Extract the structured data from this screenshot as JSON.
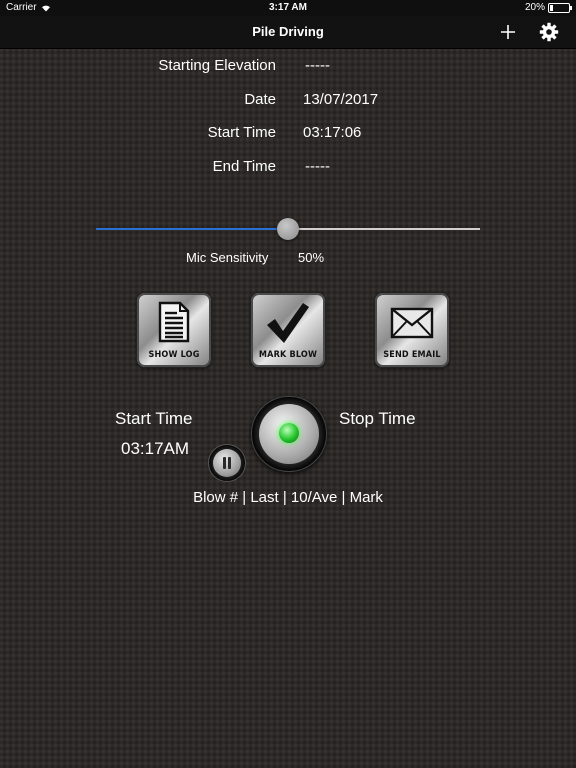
{
  "status_bar": {
    "carrier": "Carrier",
    "time": "3:17 AM",
    "battery": "20%"
  },
  "nav": {
    "title": "Pile Driving",
    "add_icon": "plus-icon",
    "settings_icon": "gear-icon"
  },
  "info": {
    "starting_elevation_label": "Starting Elevation",
    "starting_elevation_value": "-----",
    "date_label": "Date",
    "date_value": "13/07/2017",
    "start_time_label": "Start Time",
    "start_time_value": "03:17:06",
    "end_time_label": "End Time",
    "end_time_value": "-----"
  },
  "mic": {
    "label": "Mic Sensitivity",
    "value_text": "50%",
    "level": 0.5
  },
  "actions": {
    "show_log": {
      "label": "SHOW LOG",
      "icon": "document-icon"
    },
    "mark_blow": {
      "label": "MARK BLOW",
      "icon": "checkmark-icon"
    },
    "send_email": {
      "label": "SEND EMAIL",
      "icon": "envelope-icon"
    }
  },
  "timer": {
    "start_label": "Start Time",
    "start_value": "03:17AM",
    "stop_label": "Stop Time"
  },
  "blow_header": "Blow # | Last | 10/Ave | Mark",
  "colors": {
    "accent": "#2a6fd6",
    "led": "#22c32a",
    "background": "#2c2927"
  }
}
